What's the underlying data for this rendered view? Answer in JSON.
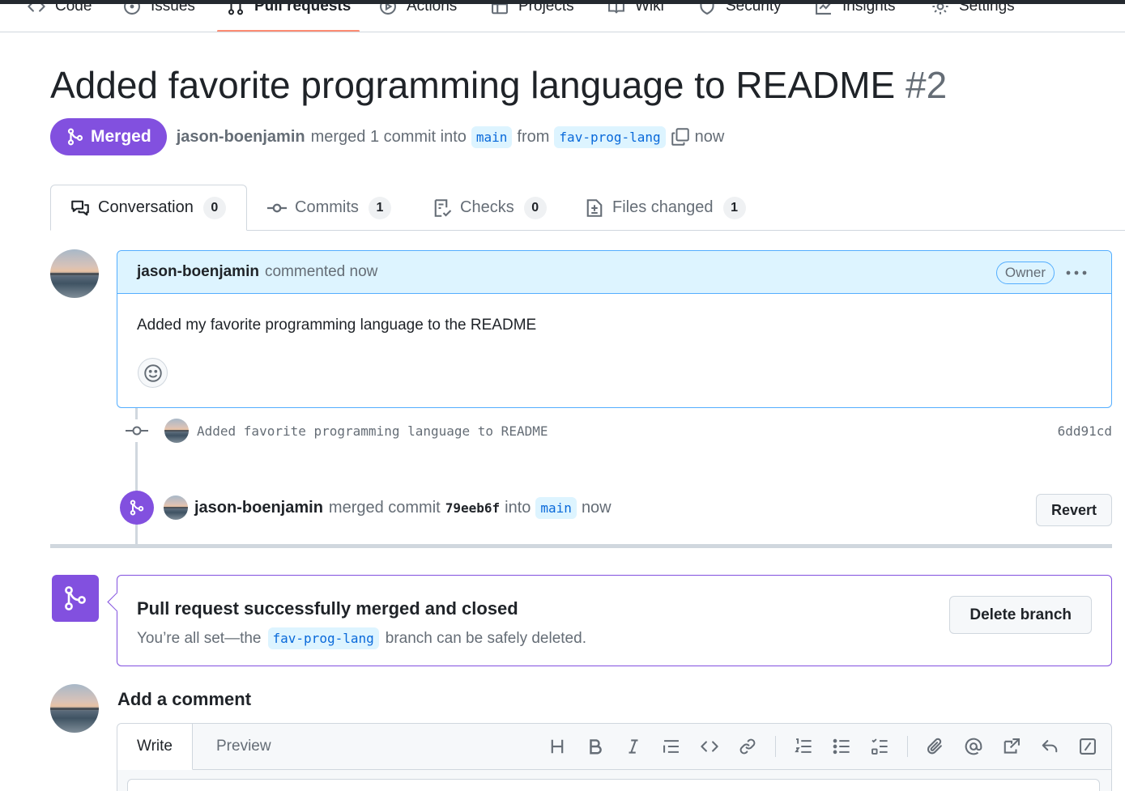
{
  "repo_nav": {
    "items": [
      {
        "label": "Code",
        "icon": "code-icon"
      },
      {
        "label": "Issues",
        "icon": "issue-icon"
      },
      {
        "label": "Pull requests",
        "icon": "pull-request-icon"
      },
      {
        "label": "Actions",
        "icon": "play-icon"
      },
      {
        "label": "Projects",
        "icon": "table-icon"
      },
      {
        "label": "Wiki",
        "icon": "book-icon"
      },
      {
        "label": "Security",
        "icon": "shield-icon"
      },
      {
        "label": "Insights",
        "icon": "graph-icon"
      },
      {
        "label": "Settings",
        "icon": "gear-icon"
      }
    ]
  },
  "pr": {
    "title": "Added favorite programming language to README",
    "number": "#2",
    "state": "Merged",
    "author": "jason-boenjamin",
    "merged_text": "merged 1 commit into",
    "base_branch": "main",
    "from_text": "from",
    "head_branch": "fav-prog-lang",
    "time": "now"
  },
  "tabs": [
    {
      "label": "Conversation",
      "count": "0",
      "icon": "comment-discussion-icon"
    },
    {
      "label": "Commits",
      "count": "1",
      "icon": "git-commit-icon"
    },
    {
      "label": "Checks",
      "count": "0",
      "icon": "checklist-icon"
    },
    {
      "label": "Files changed",
      "count": "1",
      "icon": "file-diff-icon"
    }
  ],
  "comment": {
    "author": "jason-boenjamin",
    "action": "commented now",
    "role": "Owner",
    "body": "Added my favorite programming language to the README"
  },
  "timeline": {
    "commit_message": "Added favorite programming language to README",
    "commit_sha": "6dd91cd",
    "merge_author": "jason-boenjamin",
    "merge_text": "merged commit",
    "merge_sha": "79eeb6f",
    "into_text": "into",
    "merge_branch": "main",
    "merge_time": "now",
    "revert_label": "Revert"
  },
  "merge_box": {
    "title": "Pull request successfully merged and closed",
    "desc_prefix": "You’re all set—the",
    "branch": "fav-prog-lang",
    "desc_suffix": "branch can be safely deleted.",
    "delete_label": "Delete branch"
  },
  "add_comment": {
    "title": "Add a comment",
    "write_tab": "Write",
    "preview_tab": "Preview"
  },
  "colors": {
    "merged_purple": "#8250df",
    "tab_underline": "#fd8c73",
    "comment_header_bg": "#ddf4ff"
  }
}
